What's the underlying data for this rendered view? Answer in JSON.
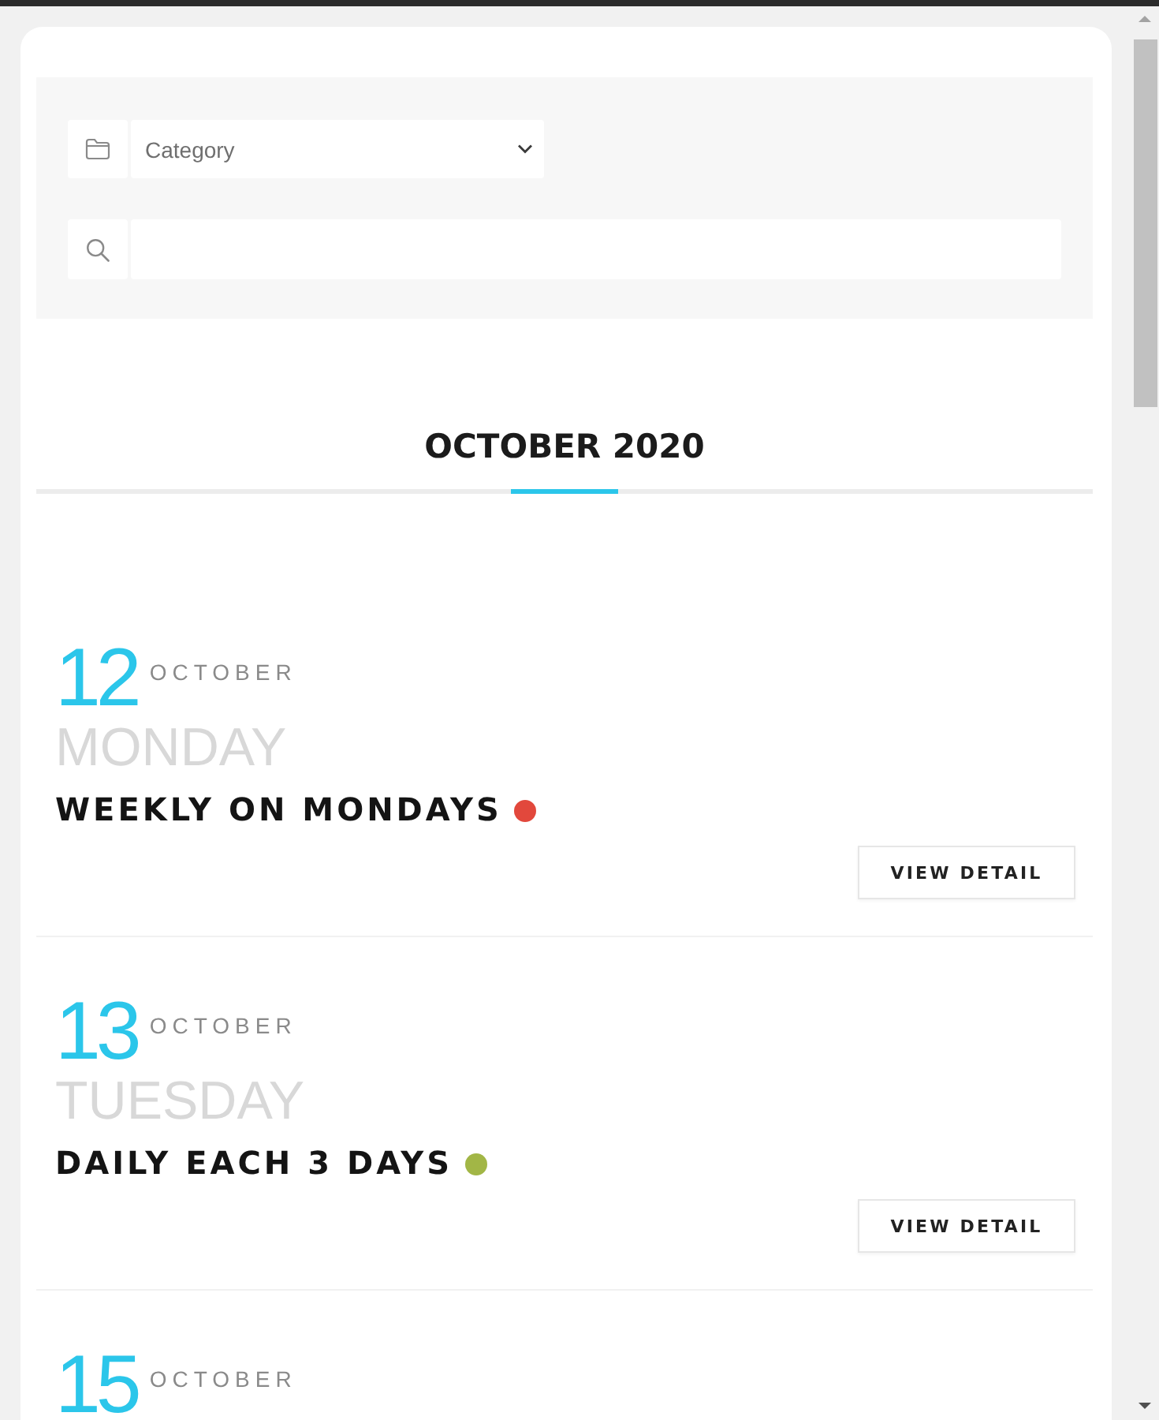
{
  "filters": [
    {
      "kind": "select",
      "value": "Category"
    },
    {
      "kind": "search"
    }
  ],
  "month_heading": "OCTOBER 2020",
  "events": [
    {
      "day": "12",
      "month": "OCTOBER",
      "weekday": "MONDAY",
      "title": "WEEKLY ON MONDAYS",
      "color": "#e2483c",
      "button": "VIEW DETAIL"
    },
    {
      "day": "13",
      "month": "OCTOBER",
      "weekday": "TUESDAY",
      "title": "DAILY EACH 3 DAYS",
      "color": "#a2b646",
      "button": "VIEW DETAIL"
    },
    {
      "day": "15",
      "month": "OCTOBER"
    }
  ]
}
